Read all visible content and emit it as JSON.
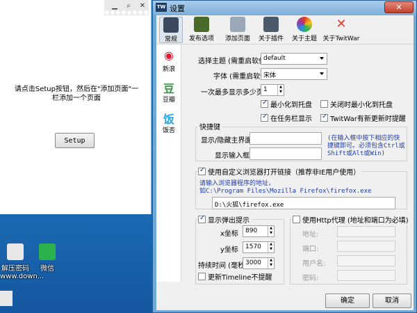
{
  "left_window": {
    "message": "请点击Setup按钮，然后在\"添加页面\"一栏添加一个页面",
    "setup_button": "Setup"
  },
  "desktop_icons": [
    {
      "label": "解压密码",
      "sublabel": "www.down...",
      "color": "#e8e8e8"
    },
    {
      "label": "微信",
      "sublabel": "",
      "color": "#2bb24c"
    }
  ],
  "dialog": {
    "app_icon_text": "TW",
    "title": "设置",
    "toolbar": [
      {
        "label": "常规",
        "icon": "monitor-icon",
        "color": "#3a4a5c"
      },
      {
        "label": "发布选项",
        "icon": "board-icon",
        "color": "#4a6a2a"
      },
      {
        "label": "添加页面",
        "icon": "contact-card-icon",
        "color": "#9aa8b8"
      },
      {
        "label": "关于插件",
        "icon": "cylinder-icon",
        "color": "#4b5a6a"
      },
      {
        "label": "关于主题",
        "icon": "color-wheel-icon",
        "color": "#d44a9c"
      },
      {
        "label": "关于TwitWar",
        "icon": "x-icon",
        "color": "#e23a2a"
      }
    ],
    "services": [
      {
        "label": "新浪",
        "icon": "weibo-icon",
        "glyph": "◉",
        "color": "#e6162d"
      },
      {
        "label": "豆瓣",
        "icon": "douban-icon",
        "glyph": "豆",
        "color": "#2e963d"
      },
      {
        "label": "饭否",
        "icon": "fanfou-icon",
        "glyph": "饭",
        "color": "#2aa6e0"
      }
    ],
    "settings": {
      "theme_label": "选择主题 (需重启软件)",
      "theme_value": "default",
      "font_label": "字体 (需重启软件)",
      "font_value": "宋体",
      "max_label": "一次最多显示多少页",
      "max_value": "1",
      "minimize_to_tray": "最小化到托盘",
      "close_to_tray": "关闭时最小化到托盘",
      "show_taskbar": "在任务栏显示",
      "notify_new": "TwitWar有新更新时提醒"
    },
    "shortcuts": {
      "heading": "快捷键",
      "toggle_label": "显示/隐藏主界面",
      "input_label": "显示输入框",
      "hint": "(在输入框中按下相应的快捷键即可。必须包含Ctrl或Shift或Alt或Win)"
    },
    "browser": {
      "checkbox": "使用自定义浏览器打开链接（推荐非IE用户使用）",
      "hint_line1": "请输入浏览器程序的地址，",
      "hint_line2": "如C:\\Program Files\\Mozilla Firefox\\firefox.exe",
      "path": "D:\\火狐\\firefox.exe"
    },
    "popup": {
      "checkbox": "显示弹出提示",
      "x_label": "x坐标",
      "x_value": "890",
      "y_label": "y坐标",
      "y_value": "1570",
      "duration_label": "持续时间 (毫秒)",
      "duration_value": "3000",
      "timeline_checkbox": "更新Timeline不提醒"
    },
    "proxy": {
      "checkbox": "使用Http代理 (地址和端口为必填)",
      "address": "地址:",
      "port": "端口:",
      "username": "用户名:",
      "password": "密码:"
    },
    "ok": "确定",
    "cancel": "取消"
  }
}
